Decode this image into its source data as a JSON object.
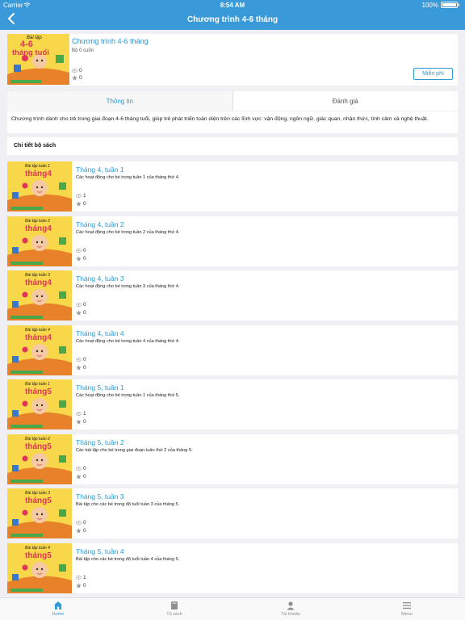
{
  "status": {
    "carrier": "Carrier",
    "time": "8:54 AM",
    "battery": "100%"
  },
  "nav": {
    "title": "Chương trình 4-6 tháng"
  },
  "summary": {
    "title": "Chương trình 4-6 tháng",
    "subtitle": "Bộ 0 cuốn",
    "views": "0",
    "rating": "0",
    "button_label": "Miễn phí",
    "cover": {
      "top": "Bài tập",
      "main": "4-6",
      "sub": "tháng tuổi"
    }
  },
  "tabs": [
    {
      "label": "Thông tin"
    },
    {
      "label": "Đánh giá"
    }
  ],
  "description": "Chương trình dành cho trẻ trong giai đoạn 4-6 tháng tuổi, giúp trẻ phát triển toàn diện trên các lĩnh vực: vận động, ngôn ngữ, giác quan, nhận thức, tình cảm và nghệ thuật.",
  "detail_header": "Chi tiết bộ sách",
  "books": [
    {
      "title": "Tháng 4, tuần 1",
      "desc": "Các hoạt động cho bé trong tuần 1 của tháng thứ 4.",
      "views": "1",
      "rating": "0",
      "cover_top": "Bài tập tuần 1",
      "cover_main": "tháng4"
    },
    {
      "title": "Tháng 4, tuần 2",
      "desc": "Các hoạt động cho bé trong tuần 2 của tháng thứ 4.",
      "views": "0",
      "rating": "0",
      "cover_top": "Bài tập tuần 2",
      "cover_main": "tháng4"
    },
    {
      "title": "Tháng 4, tuần 3",
      "desc": "Các hoạt động cho bé trong tuần 3 của tháng thứ 4.",
      "views": "0",
      "rating": "0",
      "cover_top": "Bài tập tuần 3",
      "cover_main": "tháng4"
    },
    {
      "title": "Tháng 4, tuần 4",
      "desc": "Các hoạt động cho bé trong tuần 4 của tháng thứ 4.",
      "views": "0",
      "rating": "0",
      "cover_top": "Bài tập tuần 4",
      "cover_main": "tháng4"
    },
    {
      "title": "Tháng 5, tuần 1",
      "desc": "Các hoạt động cho bé trong tuần 1 của tháng thứ 5.",
      "views": "1",
      "rating": "0",
      "cover_top": "Bài tập tuần 1",
      "cover_main": "tháng5"
    },
    {
      "title": "Tháng 5, tuần 2",
      "desc": "Các bài tập cho bé trong giai đoạn tuần thứ 2 của tháng 5.",
      "views": "0",
      "rating": "0",
      "cover_top": "Bài tập tuần 2",
      "cover_main": "tháng5"
    },
    {
      "title": "Tháng 5, tuần 3",
      "desc": "Bài tập cho các bé trong độ tuổi tuần 3 của tháng 5.",
      "views": "0",
      "rating": "0",
      "cover_top": "Bài tập tuần 3",
      "cover_main": "tháng5"
    },
    {
      "title": "Tháng 5, tuần 4",
      "desc": "Bài tập cho các bé trong độ tuổi tuần 4 của tháng 5.",
      "views": "1",
      "rating": "0",
      "cover_top": "Bài tập tuần 4",
      "cover_main": "tháng5"
    }
  ],
  "tabbar": [
    {
      "label": "Home",
      "icon": "home-icon",
      "active": true
    },
    {
      "label": "Tủ sách",
      "icon": "bookshelf-icon",
      "active": false
    },
    {
      "label": "Tài khoản",
      "icon": "account-icon",
      "active": false
    },
    {
      "label": "Menu",
      "icon": "menu-icon",
      "active": false
    }
  ],
  "colors": {
    "accent": "#3a9ad9",
    "link": "#2b9ad6",
    "cover_bg": "#f8d84a",
    "cover_title": "#e0335a"
  }
}
